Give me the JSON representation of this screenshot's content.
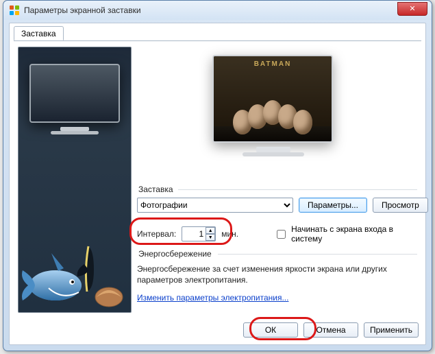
{
  "window": {
    "title": "Параметры экранной заставки",
    "close_label": "✕"
  },
  "tab": {
    "saver": "Заставка"
  },
  "preview": {
    "poster_title": "BATMAN"
  },
  "group_saver": {
    "legend": "Заставка",
    "dropdown_value": "Фотографии",
    "btn_params": "Параметры...",
    "btn_preview": "Просмотр"
  },
  "interval": {
    "label": "Интервал:",
    "value": "1",
    "unit": "мин.",
    "checkbox_label": "Начинать с экрана входа в систему"
  },
  "power": {
    "legend": "Энергосбережение",
    "text": "Энергосбережение за счет изменения яркости экрана или других параметров электропитания.",
    "link": "Изменить параметры электропитания..."
  },
  "buttons": {
    "ok": "ОК",
    "cancel": "Отмена",
    "apply": "Применить"
  }
}
